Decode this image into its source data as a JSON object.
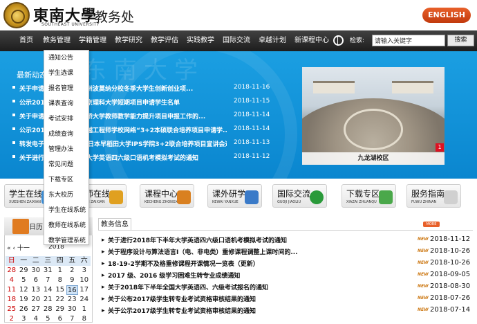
{
  "header": {
    "logo_cn": "東南大學",
    "logo_en": "SOUTHEAST UNIVERSITY",
    "site_name": "教务处",
    "english_button": "ENGLISH"
  },
  "nav": {
    "items": [
      "首页",
      "教务管理",
      "学籍管理",
      "教学研究",
      "教学评估",
      "实践教学",
      "国际交流",
      "卓越计划",
      "新课程中心"
    ],
    "search_label": "检索:",
    "search_placeholder": "请输入关键字",
    "search_button": "搜索"
  },
  "dropdown": {
    "items": [
      "通知公告",
      "学生选课",
      "报名管理",
      "课表查询",
      "考试安排",
      "成绩查询",
      "管理办法",
      "常见问题",
      "下载专区",
      "东大校历",
      "学生在线系统",
      "教师在线系统",
      "教学管理系统"
    ]
  },
  "banner": {
    "deco_text": "东南大学",
    "news_title": "最新动态",
    "news": [
      {
        "title": "关于申请2019年美国加州波莫纳分校冬季大学生创新创业项...",
        "date": "2018-11-16"
      },
      {
        "title": "公示2018年冬季学期东京理科大学短期项目申请学生名单",
        "date": "2018-11-15"
      },
      {
        "title": "关于申请2019年英国剑桥大学教师教学能力提升项目申报工作的...",
        "date": "2018-11-14"
      },
      {
        "title": "公示2018年东南大学卓越工程师学校网络“3+2本硕联合培养项目申请学...",
        "date": "2018-11-14"
      },
      {
        "title": "转发电子科学与工程学院日本早稻田大学IPS学院3+2联合培养项目宣讲会通...",
        "date": "2018-11-13"
      },
      {
        "title": "关于进行2018年下半年大学英语四六级口语机考模拟考试的通知",
        "date": "2018-11-12"
      }
    ],
    "photo_caption": "九龙湖校区",
    "photo_index": "1"
  },
  "quick_links": [
    {
      "title": "学生在线",
      "sub": "XUESHEN ZAIXIAN",
      "color": "#3a8ed8"
    },
    {
      "title": "教师在线",
      "sub": "JIAOSHI ZAIXIAN",
      "color": "#e0a020"
    },
    {
      "title": "课程中心",
      "sub": "KECHENG ZHONGXIN",
      "color": "#d98020"
    },
    {
      "title": "课外研学",
      "sub": "KEWAI YANXUE",
      "color": "#3a7ac8"
    },
    {
      "title": "国际交流",
      "sub": "GUOJI JIAOLIU",
      "color": "#2a9a3a"
    },
    {
      "title": "下载专区",
      "sub": "XIAZAI ZHUANQU",
      "color": "#4aa84a"
    },
    {
      "title": "服务指南",
      "sub": "FUWU ZHINAN",
      "color": "#d0d0d0"
    }
  ],
  "calendar": {
    "label": "日历",
    "nav": "« ‹ 十一",
    "year": "2018",
    "weekdays": [
      "日",
      "一",
      "二",
      "三",
      "四",
      "五",
      "六"
    ],
    "weeks": [
      [
        "28",
        "29",
        "30",
        "31",
        "1",
        "2",
        "3"
      ],
      [
        "4",
        "5",
        "6",
        "7",
        "8",
        "9",
        "10"
      ],
      [
        "11",
        "12",
        "13",
        "14",
        "15",
        "16",
        "17"
      ],
      [
        "18",
        "19",
        "20",
        "21",
        "22",
        "23",
        "24"
      ],
      [
        "25",
        "26",
        "27",
        "28",
        "29",
        "30",
        "1"
      ],
      [
        "2",
        "3",
        "4",
        "5",
        "6",
        "7",
        "8"
      ]
    ]
  },
  "info": {
    "tab": "教务信息",
    "more": "MORE",
    "new_badge": "NEW",
    "rows": [
      {
        "title": "关于进行2018年下半年大学英语四六级口语机考模拟考试的通知",
        "date": "2018-11-12"
      },
      {
        "title": "关于程序设计与算法语言Ⅰ（电、非电类）重修课程调整上课时间的...",
        "date": "2018-10-26"
      },
      {
        "title": "18-19-2学期不及格重修课程开课情况一览表（更新）",
        "date": "2018-10-26"
      },
      {
        "title": "2017 级、2016 级学习困难生转专业成绩通知",
        "date": "2018-09-05"
      },
      {
        "title": "关于2018年下半年全国大学英语四、六级考试报名的通知",
        "date": "2018-08-30"
      },
      {
        "title": "关于公布2017级学生转专业考试资格审核结果的通知",
        "date": "2018-07-26"
      },
      {
        "title": "关于公示2017级学生转专业考试资格审核结果的通知",
        "date": "2018-07-14"
      }
    ]
  }
}
